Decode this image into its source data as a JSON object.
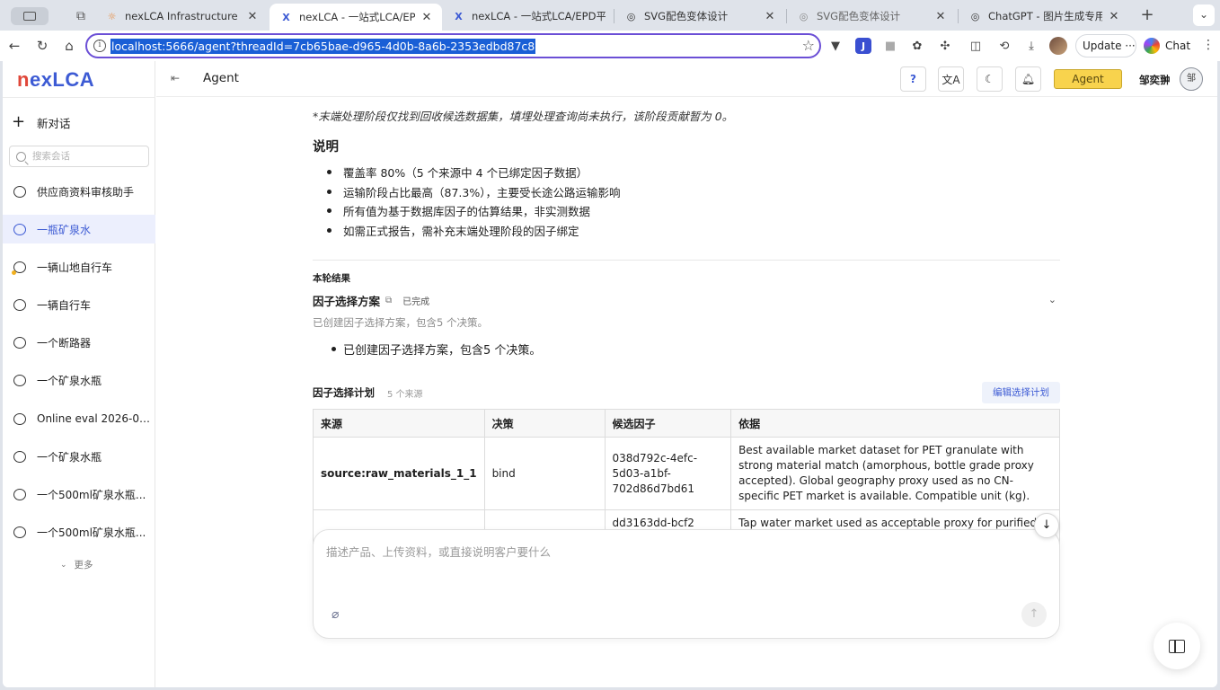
{
  "browser": {
    "tabs": [
      {
        "title": "nexLCA Infrastructure - nexLCA",
        "favicon": "sun-icon",
        "active": false
      },
      {
        "title": "nexLCA - 一站式LCA/EPD平台",
        "favicon": "x-logo-icon",
        "active": true
      },
      {
        "title": "nexLCA - 一站式LCA/EPD平台",
        "favicon": "x-logo-icon",
        "active": false
      },
      {
        "title": "SVG配色变体设计",
        "favicon": "globe-icon",
        "active": false
      },
      {
        "title": "SVG配色变体设计",
        "favicon": "globe-icon",
        "active": false
      },
      {
        "title": "ChatGPT - 图片生成专用",
        "favicon": "globe-icon",
        "active": false
      }
    ],
    "url": "localhost:5666/agent?threadId=7cb65bae-d965-4d0b-8a6b-2353edbd87c8",
    "update_label": "Update",
    "update_more": "···",
    "chat_label": "Chat"
  },
  "sidebar": {
    "logo_n": "n",
    "logo_rest": "exLCA",
    "new_chat": "新对话",
    "search_placeholder": "搜索会话",
    "conversations": [
      {
        "label": "供应商资料审核助手",
        "active": false,
        "dot": false
      },
      {
        "label": "一瓶矿泉水",
        "active": true,
        "dot": false
      },
      {
        "label": "一辆山地自行车",
        "active": false,
        "dot": true
      },
      {
        "label": "一辆自行车",
        "active": false,
        "dot": false
      },
      {
        "label": "一个断路器",
        "active": false,
        "dot": false
      },
      {
        "label": "一个矿泉水瓶",
        "active": false,
        "dot": false
      },
      {
        "label": "Online eval 2026-07...",
        "active": false,
        "dot": false
      },
      {
        "label": "一个矿泉水瓶",
        "active": false,
        "dot": false
      },
      {
        "label": "一个500ml矿泉水瓶...",
        "active": false,
        "dot": false
      },
      {
        "label": "一个500ml矿泉水瓶...",
        "active": false,
        "dot": false
      }
    ],
    "more": "更多"
  },
  "header": {
    "title": "Agent",
    "help": "?",
    "agent_button": "Agent",
    "username": "邹奕翀",
    "avatar_initial": "邹"
  },
  "content": {
    "note": "*末端处理阶段仅找到回收候选数据集，填埋处理查询尚未执行，该阶段贡献暂为 0。",
    "explain_heading": "说明",
    "bullets": [
      "覆盖率 80%（5 个来源中 4 个已绑定因子数据）",
      "运输阶段占比最高（87.3%），主要受长途公路运输影响",
      "所有值为基于数据库因子的估算结果，非实测数据",
      "如需正式报告，需补充末端处理阶段的因子绑定"
    ],
    "round_label": "本轮结果",
    "plan_title": "因子选择方案",
    "plan_status": "已完成",
    "plan_sub": "已创建因子选择方案，包含5 个决策。",
    "plan_bullet": "已创建因子选择方案，包含5 个决策。",
    "selection_title": "因子选择计划",
    "selection_count": "5 个来源",
    "edit_plan": "编辑选择计划",
    "table": {
      "headers": [
        "来源",
        "决策",
        "候选因子",
        "依据"
      ],
      "rows": [
        {
          "source": "source:raw_materials_1_1",
          "decision": "bind",
          "factor": "038d792c-4efc-5d03-a1bf-702d86d7bd61",
          "basis": "Best available market dataset for PET granulate with strong material match (amorphous, bottle grade proxy accepted). Global geography proxy used as no CN-specific PET market is available. Compatible unit (kg)."
        },
        {
          "source": "",
          "decision": "",
          "factor": "dd3163dd-bcf2",
          "basis": "Tap water market used as acceptable proxy for purified"
        }
      ]
    },
    "composer_placeholder": "描述产品、上传资料，或直接说明客户要什么"
  },
  "colors": {
    "brand_blue": "#3d5bd4",
    "brand_red": "#e0473a",
    "agent_yellow": "#f8d34d",
    "omnibox_border": "#6b4fd6",
    "url_selection": "#1a5fd6"
  }
}
